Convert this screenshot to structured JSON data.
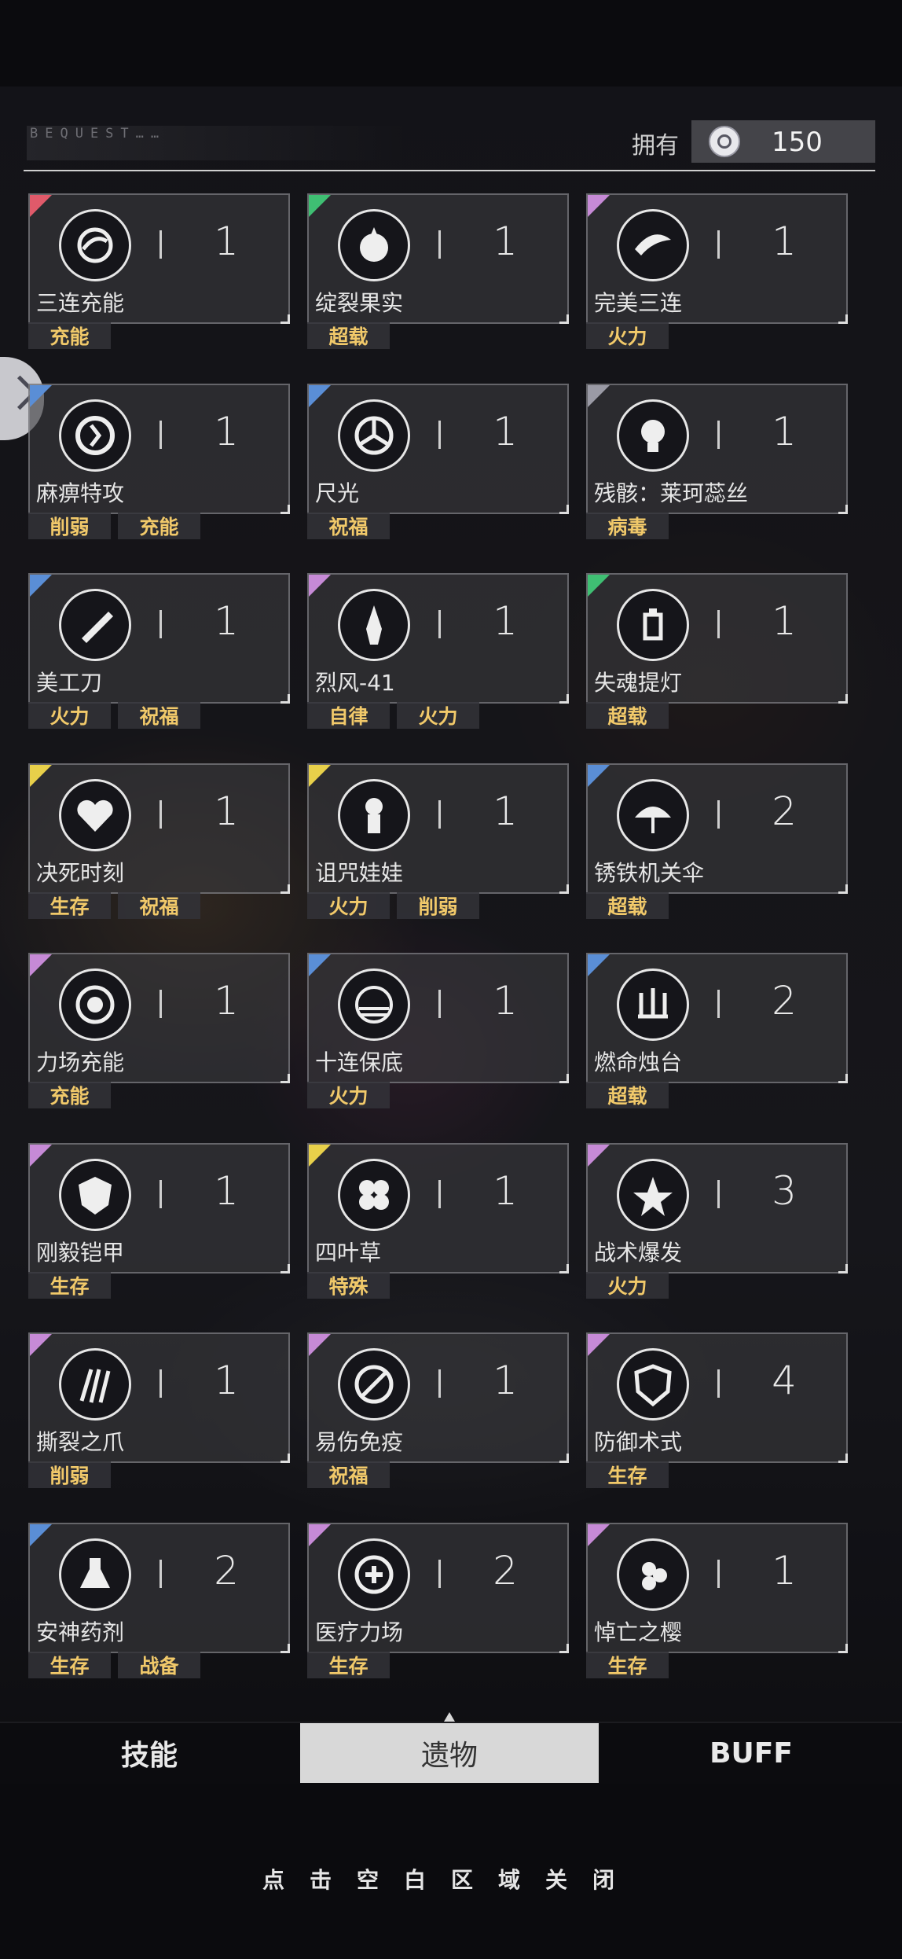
{
  "header": {
    "tag": "BEQUEST……",
    "own_label": "拥有",
    "currency_icon": "relic-coin-icon",
    "currency_value": "150"
  },
  "relics": [
    {
      "name": "三连充能",
      "count": "1",
      "corner": "#e05a6a",
      "icon": "triple-charge-icon",
      "tags": [
        "充能"
      ]
    },
    {
      "name": "绽裂果实",
      "count": "1",
      "corner": "#3fbf73",
      "icon": "burst-fruit-icon",
      "tags": [
        "超载"
      ]
    },
    {
      "name": "完美三连",
      "count": "1",
      "corner": "#c68ad6",
      "icon": "perfect-triple-icon",
      "tags": [
        "火力"
      ]
    },
    {
      "name": "麻痹特攻",
      "count": "1",
      "corner": "#5a8ed6",
      "icon": "paralyze-strike-icon",
      "tags": [
        "削弱",
        "充能"
      ]
    },
    {
      "name": "尺光",
      "count": "1",
      "corner": "#5a8ed6",
      "icon": "ruler-light-icon",
      "tags": [
        "祝福"
      ]
    },
    {
      "name": "残骸：莱珂蕊丝",
      "count": "1",
      "corner": "#9a9aa5",
      "icon": "skull-remains-icon",
      "tags": [
        "病毒"
      ]
    },
    {
      "name": "美工刀",
      "count": "1",
      "corner": "#5a8ed6",
      "icon": "utility-knife-icon",
      "tags": [
        "火力",
        "祝福"
      ]
    },
    {
      "name": "烈风-41",
      "count": "1",
      "corner": "#c68ad6",
      "icon": "rocket-icon",
      "tags": [
        "自律",
        "火力"
      ]
    },
    {
      "name": "失魂提灯",
      "count": "1",
      "corner": "#3fbf73",
      "icon": "lantern-icon",
      "tags": [
        "超载"
      ]
    },
    {
      "name": "决死时刻",
      "count": "1",
      "corner": "#e8d04a",
      "icon": "broken-heart-icon",
      "tags": [
        "生存",
        "祝福"
      ]
    },
    {
      "name": "诅咒娃娃",
      "count": "1",
      "corner": "#e8d04a",
      "icon": "voodoo-doll-icon",
      "tags": [
        "火力",
        "削弱"
      ]
    },
    {
      "name": "锈铁机关伞",
      "count": "2",
      "corner": "#5a8ed6",
      "icon": "umbrella-icon",
      "tags": [
        "超载"
      ]
    },
    {
      "name": "力场充能",
      "count": "1",
      "corner": "#c68ad6",
      "icon": "force-field-icon",
      "tags": [
        "充能"
      ]
    },
    {
      "name": "十连保底",
      "count": "1",
      "corner": "#5a8ed6",
      "icon": "ten-pull-icon",
      "tags": [
        "火力"
      ]
    },
    {
      "name": "燃命烛台",
      "count": "2",
      "corner": "#5a8ed6",
      "icon": "candelabra-icon",
      "tags": [
        "超载"
      ]
    },
    {
      "name": "刚毅铠甲",
      "count": "1",
      "corner": "#c68ad6",
      "icon": "armor-icon",
      "tags": [
        "生存"
      ]
    },
    {
      "name": "四叶草",
      "count": "1",
      "corner": "#e8d04a",
      "icon": "clover-icon",
      "tags": [
        "特殊"
      ]
    },
    {
      "name": "战术爆发",
      "count": "3",
      "corner": "#c68ad6",
      "icon": "tactical-burst-icon",
      "tags": [
        "火力"
      ]
    },
    {
      "name": "撕裂之爪",
      "count": "1",
      "corner": "#c68ad6",
      "icon": "claw-icon",
      "tags": [
        "削弱"
      ]
    },
    {
      "name": "易伤免疫",
      "count": "1",
      "corner": "#c68ad6",
      "icon": "immunity-icon",
      "tags": [
        "祝福"
      ]
    },
    {
      "name": "防御术式",
      "count": "4",
      "corner": "#c68ad6",
      "icon": "shield-icon",
      "tags": [
        "生存"
      ]
    },
    {
      "name": "安神药剂",
      "count": "2",
      "corner": "#5a8ed6",
      "icon": "potion-icon",
      "tags": [
        "生存",
        "战备"
      ]
    },
    {
      "name": "医疗力场",
      "count": "2",
      "corner": "#c68ad6",
      "icon": "medical-field-icon",
      "tags": [
        "生存"
      ]
    },
    {
      "name": "悼亡之樱",
      "count": "1",
      "corner": "#c68ad6",
      "icon": "cherry-blossom-icon",
      "tags": [
        "生存"
      ]
    }
  ],
  "tabs": [
    {
      "label": "技能"
    },
    {
      "label": "遗物"
    },
    {
      "label": "BUFF"
    }
  ],
  "close_hint": "点击空白区域关闭"
}
